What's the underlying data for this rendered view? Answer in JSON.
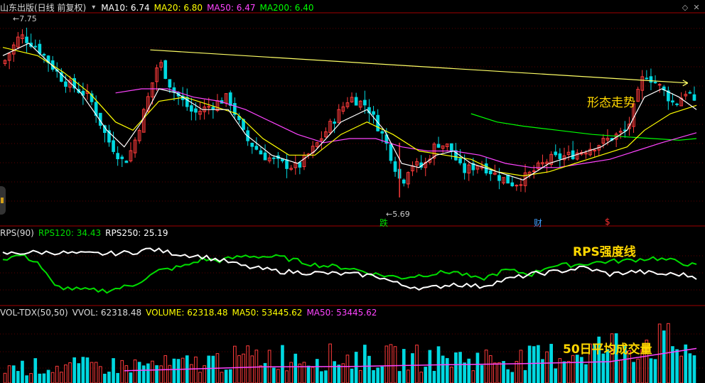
{
  "stock": {
    "name": "山东出版(日线 前复权)",
    "ma": [
      {
        "label": "MA10: 6.74",
        "color": "#ffffff"
      },
      {
        "label": "MA20: 6.80",
        "color": "#ffff00"
      },
      {
        "label": "MA50: 6.47",
        "color": "#ff44ff"
      },
      {
        "label": "MA200: 6.40",
        "color": "#00ff00"
      }
    ]
  },
  "rps": {
    "label": "RPS(90)",
    "items": [
      {
        "label": "RPS120: 34.43",
        "color": "#00dd00"
      },
      {
        "label": "RPS250: 25.19",
        "color": "#ffffff"
      }
    ]
  },
  "volume": {
    "label": "VOL-TDX(50,50)",
    "items": [
      {
        "label": "VVOL: 62318.48",
        "color": "#dddddd"
      },
      {
        "label": "VOLUME: 62318.48",
        "color": "#ffff00"
      },
      {
        "label": "MA50: 53445.62",
        "color": "#ffff00"
      },
      {
        "label": "MA50: 53445.62",
        "color": "#ff44ff"
      }
    ]
  },
  "annotations": {
    "pattern": "形态走势",
    "rps": "RPS强度线",
    "vol_num": "50",
    "vol_text": "日平均成交量"
  },
  "markers": {
    "high": "7.75",
    "low": "5.69",
    "m1": "跌",
    "m2": "财",
    "m3": "$"
  },
  "colors": {
    "up": "#ff3b3b",
    "down": "#00d8e0",
    "bg": "#000000",
    "grid": "#8b0000"
  },
  "chart_data": [
    {
      "type": "candlestick",
      "title": "山东出版(日线 前复权)",
      "ylim": [
        5.5,
        7.9
      ],
      "x_count": 160,
      "notable": {
        "high": 7.75,
        "low": 5.69
      },
      "close_path": [
        [
          0,
          7.3
        ],
        [
          4,
          7.65
        ],
        [
          8,
          7.5
        ],
        [
          14,
          7.1
        ],
        [
          20,
          6.9
        ],
        [
          24,
          6.4
        ],
        [
          28,
          6.1
        ],
        [
          30,
          6.3
        ],
        [
          33,
          6.8
        ],
        [
          36,
          7.35
        ],
        [
          39,
          7.0
        ],
        [
          44,
          6.7
        ],
        [
          48,
          6.8
        ],
        [
          52,
          6.9
        ],
        [
          56,
          6.4
        ],
        [
          60,
          6.2
        ],
        [
          64,
          6.1
        ],
        [
          68,
          6.05
        ],
        [
          72,
          6.3
        ],
        [
          76,
          6.6
        ],
        [
          80,
          6.9
        ],
        [
          84,
          6.8
        ],
        [
          88,
          6.4
        ],
        [
          92,
          5.85
        ],
        [
          94,
          6.1
        ],
        [
          97,
          6.05
        ],
        [
          100,
          6.35
        ],
        [
          103,
          6.3
        ],
        [
          106,
          6.0
        ],
        [
          110,
          6.1
        ],
        [
          114,
          5.95
        ],
        [
          118,
          5.85
        ],
        [
          121,
          5.95
        ],
        [
          126,
          6.15
        ],
        [
          131,
          6.2
        ],
        [
          136,
          6.3
        ],
        [
          140,
          6.4
        ],
        [
          144,
          6.5
        ],
        [
          148,
          7.2
        ],
        [
          152,
          7.0
        ],
        [
          155,
          6.8
        ],
        [
          158,
          7.0
        ],
        [
          160,
          6.74
        ]
      ],
      "ma10": [
        [
          0,
          7.4
        ],
        [
          6,
          7.55
        ],
        [
          12,
          7.25
        ],
        [
          18,
          6.95
        ],
        [
          24,
          6.5
        ],
        [
          28,
          6.3
        ],
        [
          32,
          6.6
        ],
        [
          36,
          7.0
        ],
        [
          40,
          6.95
        ],
        [
          46,
          6.75
        ],
        [
          52,
          6.75
        ],
        [
          56,
          6.45
        ],
        [
          62,
          6.2
        ],
        [
          68,
          6.1
        ],
        [
          72,
          6.25
        ],
        [
          78,
          6.6
        ],
        [
          84,
          6.75
        ],
        [
          88,
          6.5
        ],
        [
          92,
          6.1
        ],
        [
          96,
          6.05
        ],
        [
          100,
          6.2
        ],
        [
          104,
          6.25
        ],
        [
          108,
          6.1
        ],
        [
          114,
          6.0
        ],
        [
          120,
          5.9
        ],
        [
          126,
          6.1
        ],
        [
          132,
          6.2
        ],
        [
          138,
          6.3
        ],
        [
          144,
          6.5
        ],
        [
          148,
          6.9
        ],
        [
          152,
          7.0
        ],
        [
          156,
          6.9
        ],
        [
          160,
          6.75
        ]
      ],
      "ma20": [
        [
          0,
          7.5
        ],
        [
          8,
          7.4
        ],
        [
          14,
          7.2
        ],
        [
          20,
          6.95
        ],
        [
          26,
          6.6
        ],
        [
          30,
          6.5
        ],
        [
          36,
          6.85
        ],
        [
          42,
          6.9
        ],
        [
          48,
          6.8
        ],
        [
          54,
          6.7
        ],
        [
          60,
          6.4
        ],
        [
          66,
          6.2
        ],
        [
          72,
          6.2
        ],
        [
          78,
          6.45
        ],
        [
          84,
          6.6
        ],
        [
          90,
          6.45
        ],
        [
          96,
          6.25
        ],
        [
          102,
          6.2
        ],
        [
          108,
          6.15
        ],
        [
          114,
          6.0
        ],
        [
          120,
          5.95
        ],
        [
          126,
          6.0
        ],
        [
          132,
          6.1
        ],
        [
          138,
          6.2
        ],
        [
          144,
          6.3
        ],
        [
          148,
          6.5
        ],
        [
          154,
          6.7
        ],
        [
          160,
          6.8
        ]
      ],
      "ma50": [
        [
          26,
          6.95
        ],
        [
          32,
          7.0
        ],
        [
          38,
          7.0
        ],
        [
          44,
          6.9
        ],
        [
          50,
          6.85
        ],
        [
          56,
          6.75
        ],
        [
          62,
          6.6
        ],
        [
          68,
          6.45
        ],
        [
          74,
          6.35
        ],
        [
          80,
          6.4
        ],
        [
          86,
          6.4
        ],
        [
          92,
          6.3
        ],
        [
          98,
          6.25
        ],
        [
          104,
          6.25
        ],
        [
          110,
          6.2
        ],
        [
          116,
          6.1
        ],
        [
          122,
          6.05
        ],
        [
          128,
          6.05
        ],
        [
          134,
          6.1
        ],
        [
          140,
          6.15
        ],
        [
          146,
          6.25
        ],
        [
          152,
          6.35
        ],
        [
          160,
          6.47
        ]
      ],
      "ma200": [
        [
          108,
          6.7
        ],
        [
          114,
          6.6
        ],
        [
          120,
          6.55
        ],
        [
          128,
          6.5
        ],
        [
          136,
          6.45
        ],
        [
          144,
          6.42
        ],
        [
          150,
          6.4
        ],
        [
          156,
          6.38
        ],
        [
          160,
          6.4
        ]
      ],
      "trendline": [
        [
          34,
          7.47
        ],
        [
          158,
          7.07
        ]
      ]
    },
    {
      "type": "line",
      "title": "RPS(90)",
      "ylim": [
        0,
        100
      ],
      "series": [
        {
          "name": "RPS120",
          "color": "#00dd00",
          "values": [
            [
              0,
              70
            ],
            [
              4,
              76
            ],
            [
              8,
              66
            ],
            [
              12,
              30
            ],
            [
              18,
              25
            ],
            [
              24,
              24
            ],
            [
              30,
              32
            ],
            [
              36,
              53
            ],
            [
              42,
              60
            ],
            [
              46,
              70
            ],
            [
              50,
              68
            ],
            [
              56,
              75
            ],
            [
              64,
              73
            ],
            [
              72,
              62
            ],
            [
              80,
              57
            ],
            [
              86,
              48
            ],
            [
              92,
              43
            ],
            [
              98,
              48
            ],
            [
              104,
              52
            ],
            [
              110,
              40
            ],
            [
              116,
              54
            ],
            [
              122,
              48
            ],
            [
              126,
              60
            ],
            [
              132,
              62
            ],
            [
              138,
              66
            ],
            [
              144,
              68
            ],
            [
              150,
              72
            ],
            [
              156,
              66
            ],
            [
              160,
              60
            ]
          ]
        },
        {
          "name": "RPS250",
          "color": "#ffffff",
          "values": [
            [
              0,
              78
            ],
            [
              6,
              80
            ],
            [
              12,
              80
            ],
            [
              18,
              78
            ],
            [
              24,
              78
            ],
            [
              30,
              80
            ],
            [
              34,
              85
            ],
            [
              40,
              78
            ],
            [
              46,
              74
            ],
            [
              52,
              66
            ],
            [
              56,
              59
            ],
            [
              64,
              52
            ],
            [
              72,
              50
            ],
            [
              80,
              48
            ],
            [
              86,
              46
            ],
            [
              92,
              32
            ],
            [
              98,
              27
            ],
            [
              104,
              34
            ],
            [
              110,
              30
            ],
            [
              116,
              40
            ],
            [
              122,
              48
            ],
            [
              128,
              52
            ],
            [
              134,
              58
            ],
            [
              140,
              48
            ],
            [
              146,
              52
            ],
            [
              152,
              48
            ],
            [
              156,
              48
            ],
            [
              160,
              44
            ]
          ]
        }
      ]
    },
    {
      "type": "bar",
      "title": "VOL-TDX(50,50)",
      "ylim": [
        0,
        100000
      ],
      "series": [
        {
          "name": "MA50",
          "color": "#ff44ff",
          "values": [
            [
              28,
              19000
            ],
            [
              40,
              21000
            ],
            [
              60,
              25000
            ],
            [
              80,
              25500
            ],
            [
              100,
              28000
            ],
            [
              120,
              30000
            ],
            [
              140,
              33000
            ],
            [
              160,
              53445.62
            ]
          ]
        }
      ],
      "values_envelope": [
        [
          0,
          30000
        ],
        [
          40,
          35000
        ],
        [
          60,
          52000
        ],
        [
          80,
          48000
        ],
        [
          100,
          48000
        ],
        [
          120,
          45000
        ],
        [
          140,
          70000
        ],
        [
          150,
          80000
        ],
        [
          160,
          62318.48
        ]
      ]
    }
  ]
}
